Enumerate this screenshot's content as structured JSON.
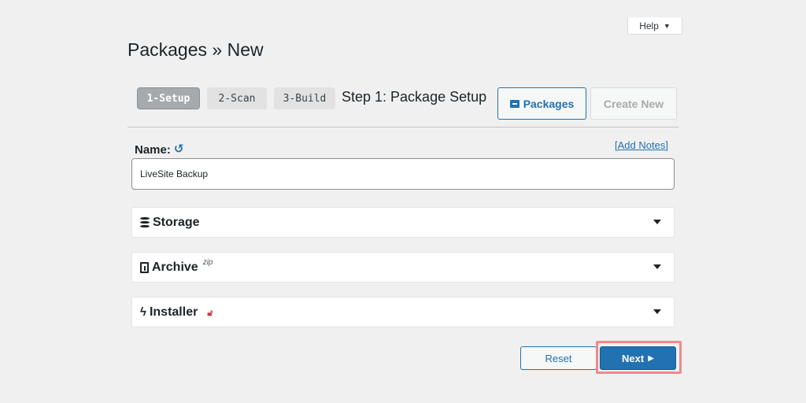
{
  "help": {
    "label": "Help",
    "caret": "▼"
  },
  "page": {
    "title": "Packages » New"
  },
  "steps": [
    {
      "label": "1-Setup",
      "active": true
    },
    {
      "label": "2-Scan",
      "active": false
    },
    {
      "label": "3-Build",
      "active": false
    }
  ],
  "step_heading": "Step 1: Package Setup",
  "toolbar": {
    "packages_label": "Packages",
    "create_new_label": "Create New"
  },
  "name_field": {
    "label": "Name:",
    "undo_icon": "undo-icon",
    "value": "LiveSite Backup",
    "add_notes_label": "[Add Notes]"
  },
  "panels": [
    {
      "title": "Storage",
      "icon": "database-icon"
    },
    {
      "title": "Archive",
      "icon": "file-archive-icon",
      "sup": "zip"
    },
    {
      "title": "Installer",
      "icon": "bolt-icon",
      "badge_icon": "unlock-icon"
    }
  ],
  "actions": {
    "reset_label": "Reset",
    "next_label": "Next",
    "next_icon": "▶"
  },
  "colors": {
    "accent": "#2271b1",
    "highlight": "#f08a8a",
    "lock": "#d63638"
  }
}
